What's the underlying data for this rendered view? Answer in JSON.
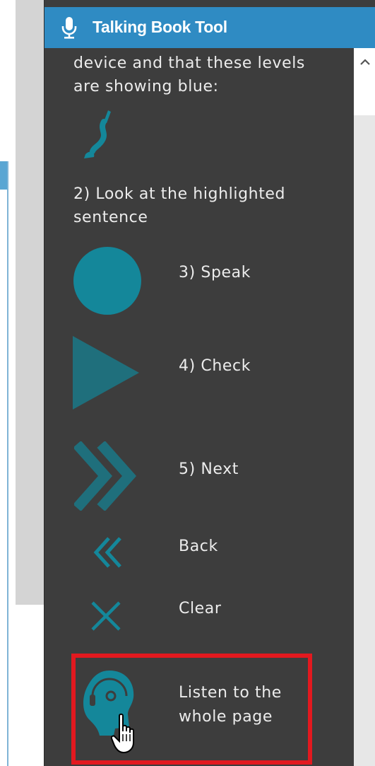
{
  "pane": {
    "title": "Talking Book Tool",
    "intro_text": "device and that these levels are showing blue:",
    "step2_text": "2) Look at the highlighted sentence"
  },
  "actions": {
    "speak": "3) Speak",
    "check": "4) Check",
    "next": "5) Next",
    "back": "Back",
    "clear": "Clear",
    "listen": "Listen to the whole page"
  },
  "colors": {
    "header_bg": "#2f8bc3",
    "pane_bg": "#3d3d3d",
    "accent_teal": "#14879a",
    "highlight_red": "#e2191f"
  },
  "icons": {
    "header": "microphone-icon",
    "levels": "audio-cable-icon",
    "speak": "record-circle-icon",
    "check": "play-triangle-icon",
    "next": "double-chevron-right-icon",
    "back": "double-chevron-left-icon",
    "clear": "close-x-icon",
    "listen": "head-headphones-icon",
    "cursor": "hand-pointer-icon"
  }
}
